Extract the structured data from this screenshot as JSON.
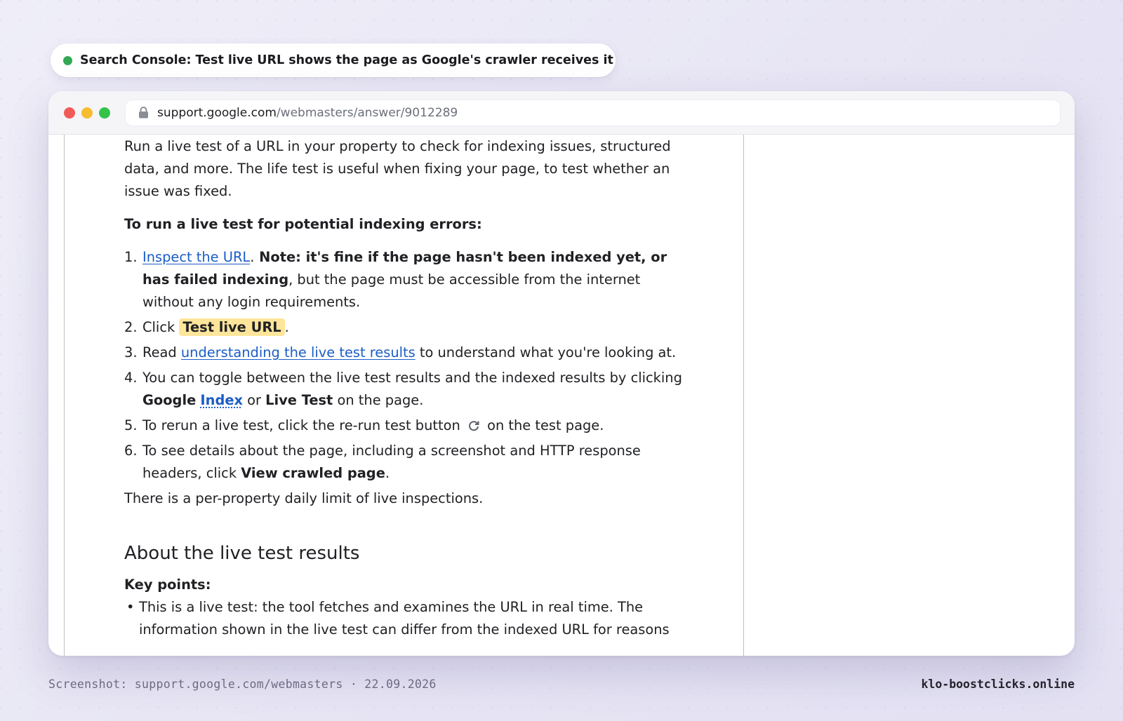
{
  "caption": {
    "text": "Search Console: Test live URL shows the page as Google's crawler receives it",
    "status_color": "#33a853"
  },
  "browser": {
    "url_domain": "support.google.com",
    "url_path": "/webmasters/answer/9012289",
    "icons": [
      "close-traffic-light",
      "minimize-traffic-light",
      "maximize-traffic-light",
      "lock-icon"
    ]
  },
  "article": {
    "intro": "Run a live test of a URL in your property to check for indexing issues, structured data, and more. The life test is useful when fixing your page, to test whether an issue was fixed.",
    "subheading": "To run a live test for potential indexing errors:",
    "steps": {
      "s1": {
        "num": "1.",
        "link": "Inspect the URL",
        "sep": ".",
        "bold": " Note: it's fine if the page hasn't been indexed yet, or has failed indexing",
        "rest": ", but the page must be accessible from the internet without any login requirements."
      },
      "s2": {
        "num": "2.",
        "pre": "Click ",
        "highlight": "Test live URL",
        "post": "."
      },
      "s3": {
        "num": "3.",
        "pre": "Read ",
        "link": "understanding the live test results",
        "post": " to understand what you're looking at."
      },
      "s4": {
        "num": "4.",
        "pre": "You can toggle between the live test results and the indexed results by clicking ",
        "bold1": "Google",
        "link": "Index",
        "mid": " or ",
        "bold2": "Live Test",
        "post": " on the page."
      },
      "s5": {
        "num": "5.",
        "pre": "To rerun a live test, click the re-run test button",
        "post": "on the test page."
      },
      "s6": {
        "num": "6.",
        "pre": "To see details about the page, including a screenshot and HTTP response headers, click ",
        "bold": "View crawled page",
        "post": "."
      }
    },
    "limit_note": "There is a per-property daily limit of live inspections.",
    "section_heading": "About the live test results",
    "key_points_label": "Key points:",
    "bullet_1": "This is a live test: the tool fetches and examines the URL in real time. The information shown in the live test can differ from the indexed URL for reasons"
  },
  "footer": {
    "left": "Screenshot: support.google.com/webmasters · 22.09.2026",
    "right": "klo-boostclicks.online"
  },
  "colors": {
    "link": "#1a5dc6",
    "highlight": "#fde59a"
  }
}
